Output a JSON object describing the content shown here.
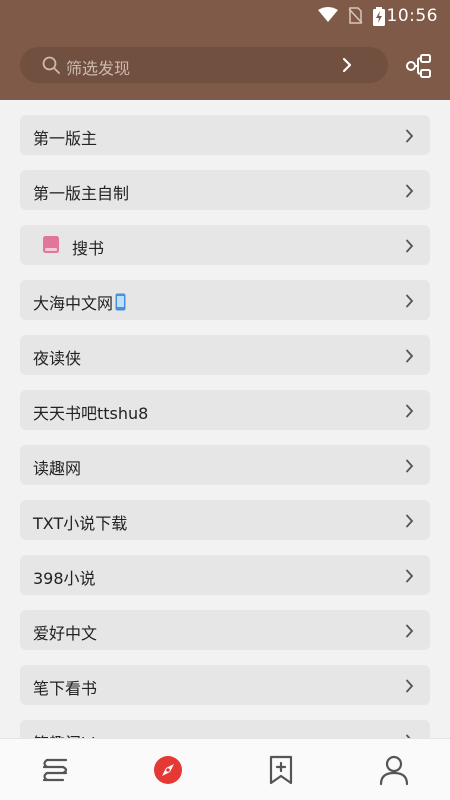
{
  "status_bar": {
    "time": "10:56"
  },
  "search": {
    "placeholder": "筛选发现"
  },
  "list": {
    "items": [
      {
        "label": "第一版主"
      },
      {
        "label": "第一版主自制"
      },
      {
        "label": "搜书",
        "icon": "book-icon"
      },
      {
        "label": "大海中文网",
        "trailing_icon": "phone-icon"
      },
      {
        "label": "夜读侠"
      },
      {
        "label": "天天书吧ttshu8"
      },
      {
        "label": "读趣网"
      },
      {
        "label": "TXT小说下载"
      },
      {
        "label": "398小说"
      },
      {
        "label": "爱好中文"
      },
      {
        "label": "笔下看书"
      },
      {
        "label": "笔趣阁hk"
      }
    ]
  },
  "bottom_nav": {
    "items": [
      {
        "icon": "bookshelf-icon"
      },
      {
        "icon": "compass-icon",
        "active": true
      },
      {
        "icon": "bookmark-add-icon"
      },
      {
        "icon": "profile-icon"
      }
    ]
  },
  "colors": {
    "header": "#7f5a48",
    "active_tab": "#e53935",
    "item_bg": "#e6e6e6",
    "background": "#f2f2f2"
  }
}
